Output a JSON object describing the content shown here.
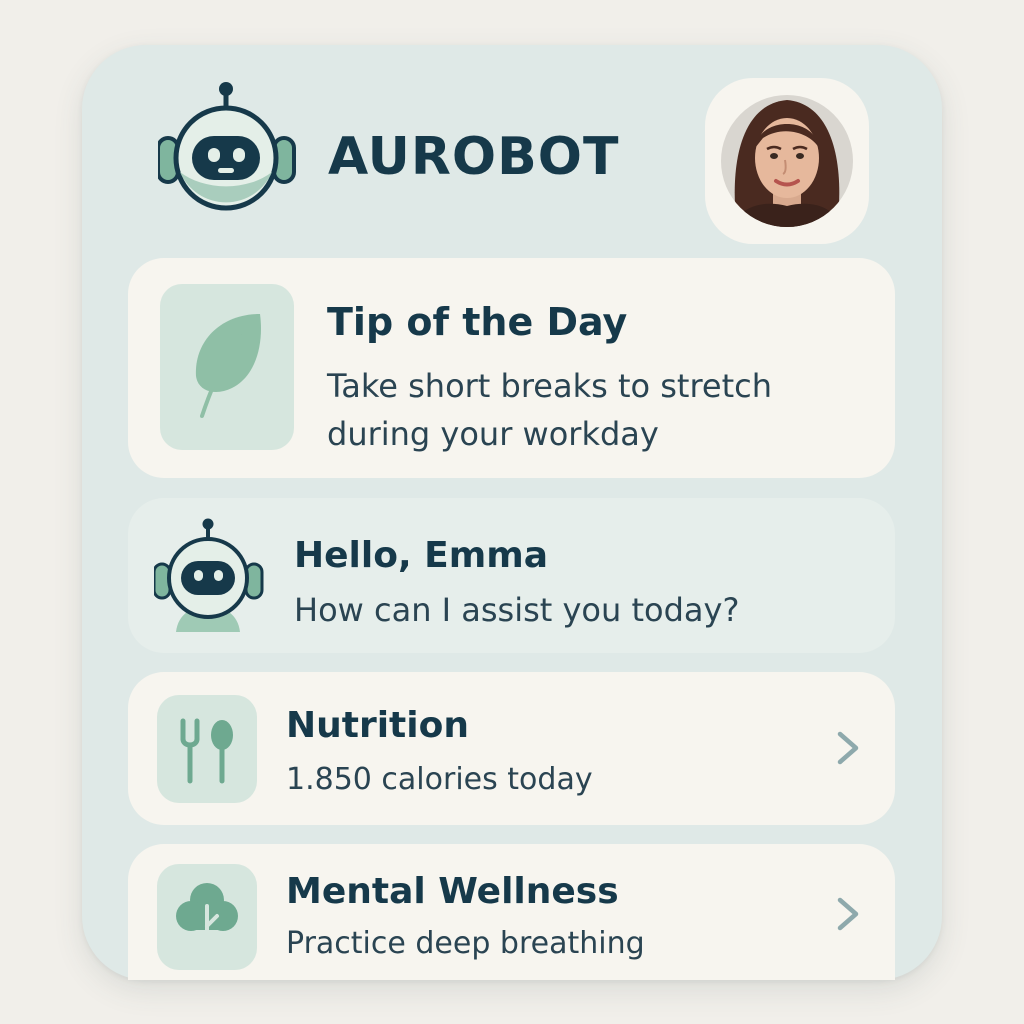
{
  "header": {
    "brand": "AUROBOT",
    "logo_icon": "robot-icon",
    "avatar": "user-avatar"
  },
  "tip_card": {
    "title": "Tip of the Day",
    "text_line1": "Take short breaks to stretch",
    "text_line2": "during your workday",
    "icon": "leaf-icon"
  },
  "greeting_card": {
    "title": "Hello, Emma",
    "subtitle": "How can I assist you today?",
    "icon": "robot-icon"
  },
  "items": [
    {
      "title": "Nutrition",
      "subtitle": "1.850  calories today",
      "icon": "fork-spoon-icon",
      "action_icon": "chevron-right-icon"
    },
    {
      "title": "Mental Wellness",
      "subtitle": "Practice deep breathing",
      "icon": "tree-icon",
      "action_icon": "chevron-right-icon"
    }
  ],
  "colors": {
    "background": "#f1efea",
    "panel": "#dfe9e7",
    "card": "#f7f5ef",
    "primary_text": "#16394a",
    "accent": "#7fb59e"
  }
}
